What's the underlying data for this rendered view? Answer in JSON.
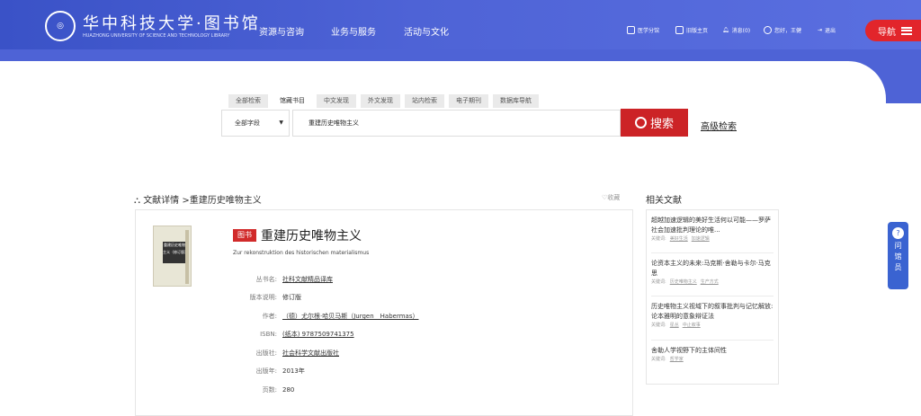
{
  "header": {
    "logo_title": "华中科技大学·图书馆",
    "logo_sub": "HUAZHONG UNIVERSITY OF SCIENCE AND TECHNOLOGY LIBRARY",
    "nav": [
      "资源与咨询",
      "业务与服务",
      "活动与文化"
    ],
    "top_links": [
      "医学分馆",
      "旧版主页",
      "消息(0)",
      "您好，王健",
      "退出"
    ],
    "nav_button": "导航",
    "accent": "#4e63d6"
  },
  "search": {
    "tabs": [
      "全部检索",
      "馆藏书目",
      "中文发现",
      "外文发现",
      "站内检索",
      "电子期刊",
      "数据库导航"
    ],
    "field": "全部字段",
    "query": "重建历史唯物主义",
    "button": "搜索",
    "advanced": "高级检索",
    "button_color": "#cc2326"
  },
  "breadcrumb": {
    "root": "文献详情",
    "sep": ">",
    "current": "重建历史唯物主义"
  },
  "favorite": "收藏",
  "book": {
    "badge": "图书",
    "title": "重建历史唯物主义",
    "subtitle": "Zur rekonstruktion des historischen materialismus",
    "cover_text": "重建历史唯物主义（修订版）",
    "meta": [
      {
        "key": "丛书名:",
        "value": "社科文献精品译库",
        "link": true
      },
      {
        "key": "版本说明:",
        "value": "修订版",
        "link": false
      },
      {
        "key": "作者:",
        "value": "（德）尤尔根·哈贝马斯（Jurgen　Habermas）",
        "link": true
      },
      {
        "key": "ISBN:",
        "value": "(纸本) 9787509741375",
        "link": true
      },
      {
        "key": "出版社:",
        "value": "社会科学文献出版社",
        "link": true
      },
      {
        "key": "出版年:",
        "value": "2013年",
        "link": false
      },
      {
        "key": "页数:",
        "value": "280",
        "link": false
      }
    ]
  },
  "related": {
    "title": "相关文献",
    "kw_label": "关键词:",
    "items": [
      {
        "title": "超越加速逻辑的美好生活何以可能——罗萨社会加速批判理论的唯...",
        "keywords": [
          "美好生活",
          "加速逻辑"
        ]
      },
      {
        "title": "论资本主义的未来:马克斯·舍勒与卡尔·马克思",
        "keywords": [
          "历史唯物主义",
          "生产方式"
        ]
      },
      {
        "title": "历史唯物主义视域下的叙事批判与记忆解放:论本雅明的意象辩证法",
        "keywords": [
          "星丛",
          "中止叙事"
        ]
      },
      {
        "title": "舍勒人学视野下的主体间性",
        "keywords": [
          "哲学家"
        ]
      }
    ]
  },
  "helper": {
    "label": "问馆员",
    "icon": "?"
  }
}
